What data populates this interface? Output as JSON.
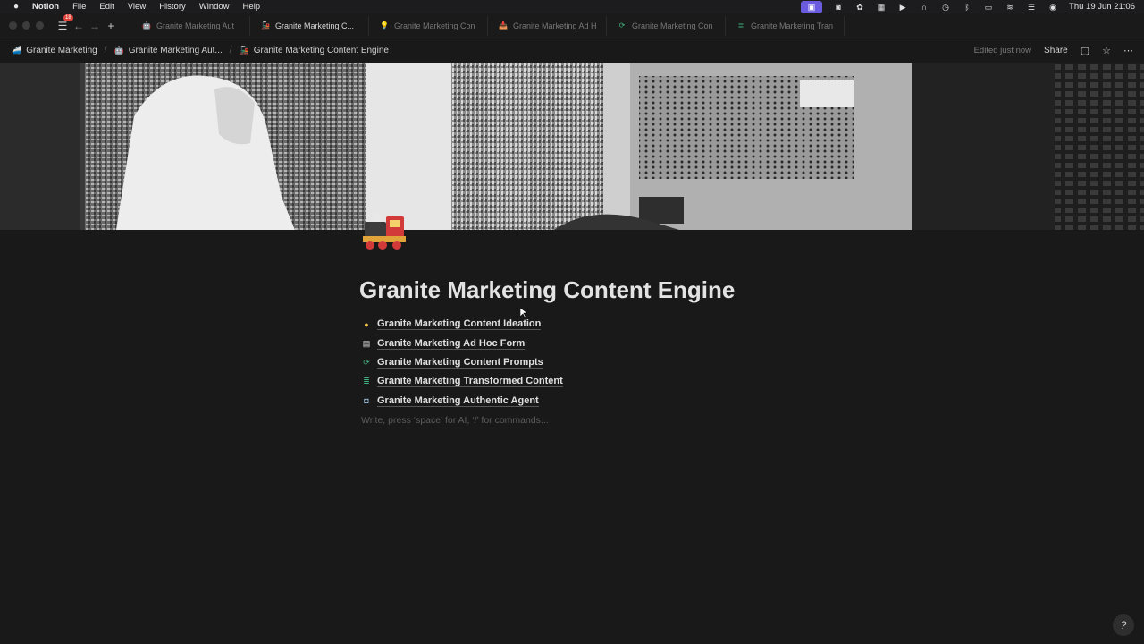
{
  "menubar": {
    "app_name": "Notion",
    "items": [
      "File",
      "Edit",
      "View",
      "History",
      "Window",
      "Help"
    ],
    "clock": "Thu 19 Jun  21:06"
  },
  "tabbar": {
    "badge_count": "18",
    "tabs": [
      {
        "label": "Granite Marketing Aut",
        "icon": "robot-icon",
        "active": false
      },
      {
        "label": "Granite Marketing C...",
        "icon": "train-icon",
        "active": true
      },
      {
        "label": "Granite Marketing Con",
        "icon": "lightbulb-icon",
        "active": false
      },
      {
        "label": "Granite Marketing Ad H",
        "icon": "inbox-icon",
        "active": false
      },
      {
        "label": "Granite Marketing Con",
        "icon": "refresh-icon",
        "active": false
      },
      {
        "label": "Granite Marketing Tran",
        "icon": "database-icon",
        "active": false
      }
    ]
  },
  "breadcrumb": {
    "items": [
      {
        "label": "Granite Marketing",
        "icon": "workspace-icon"
      },
      {
        "label": "Granite Marketing Aut...",
        "icon": "robot-icon"
      },
      {
        "label": "Granite Marketing Content Engine",
        "icon": "train-icon"
      }
    ],
    "edited": "Edited just now",
    "share": "Share"
  },
  "page": {
    "title": "Granite Marketing Content Engine",
    "links": [
      {
        "label": "Granite Marketing Content Ideation",
        "icon": "lightbulb-icon"
      },
      {
        "label": "Granite Marketing Ad Hoc Form",
        "icon": "inbox-icon"
      },
      {
        "label": "Granite Marketing Content Prompts",
        "icon": "refresh-icon"
      },
      {
        "label": "Granite Marketing Transformed Content",
        "icon": "database-icon"
      },
      {
        "label": "Granite Marketing Authentic Agent",
        "icon": "robot-icon"
      }
    ],
    "placeholder": "Write, press ‘space’ for AI, ‘/’ for commands..."
  },
  "colors": {
    "background": "#191919",
    "accent": "#6b5be0"
  }
}
